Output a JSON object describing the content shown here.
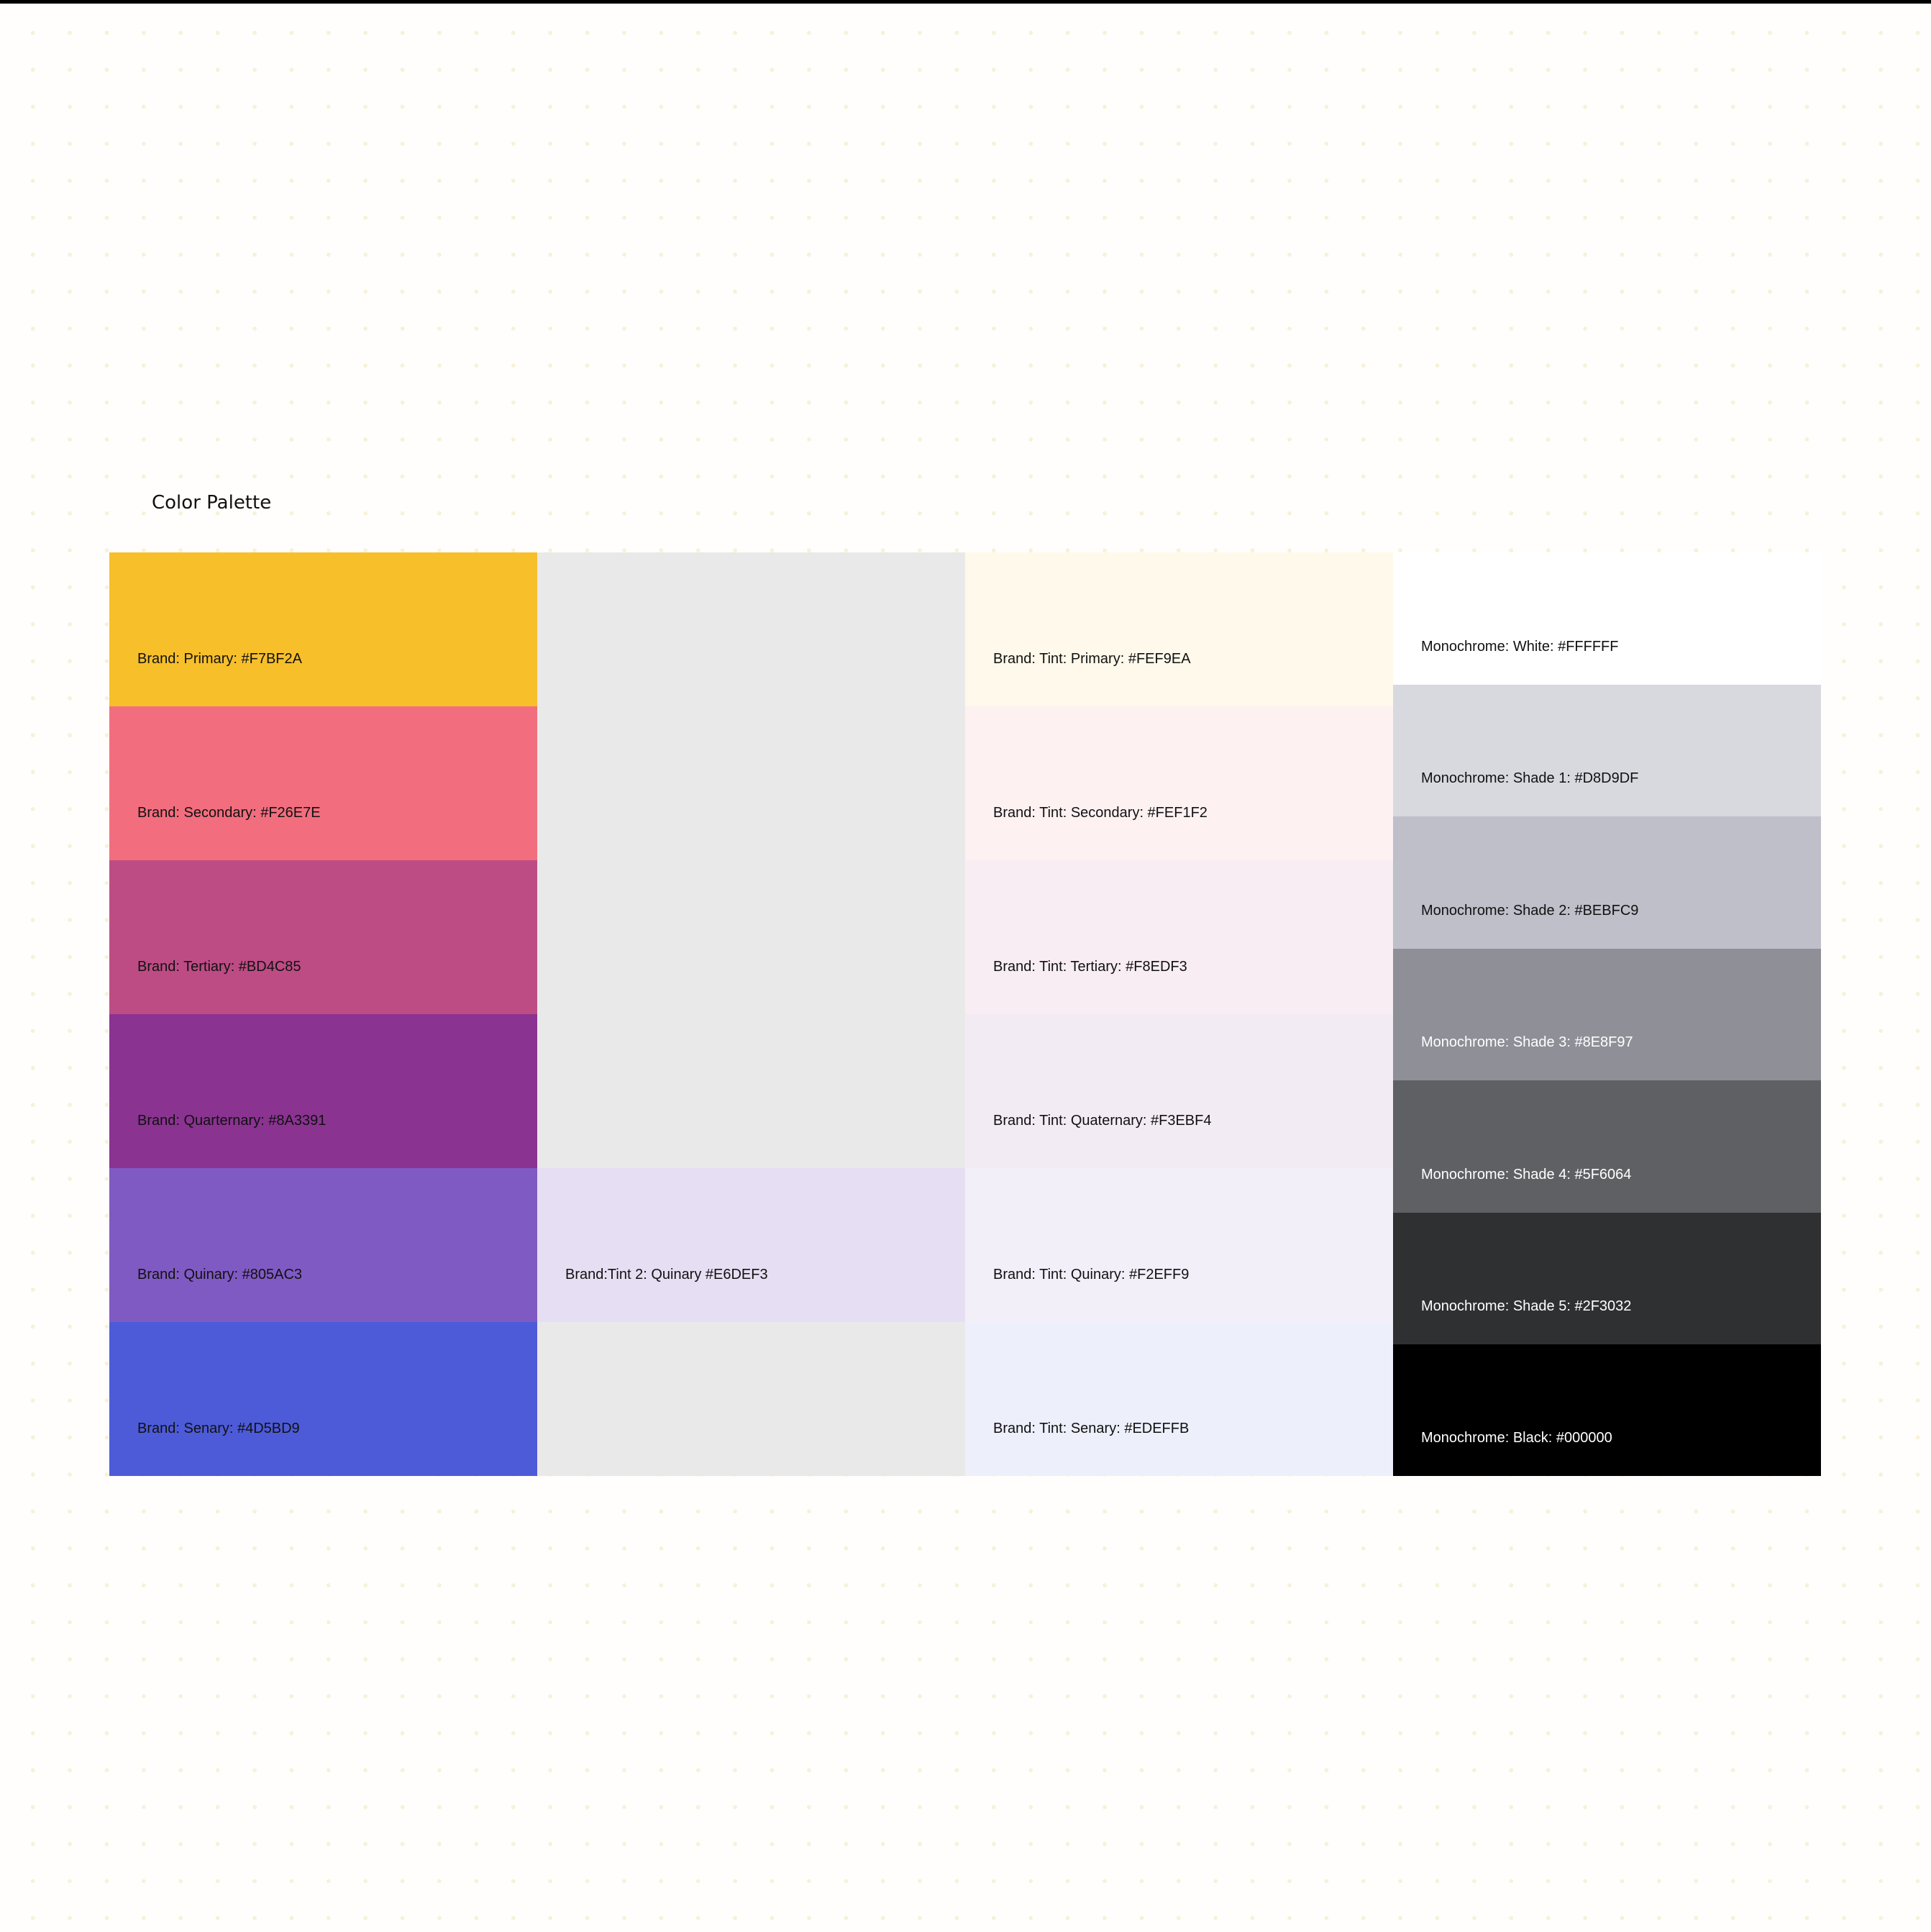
{
  "page": {
    "title": "Color Palette"
  },
  "brand": {
    "primary": {
      "label": "Brand: Primary: #F7BF2A",
      "color": "#F7BF2A"
    },
    "secondary": {
      "label": "Brand: Secondary: #F26E7E",
      "color": "#F26E7E"
    },
    "tertiary": {
      "label": "Brand: Tertiary: #BD4C85",
      "color": "#BD4C85"
    },
    "quaternary": {
      "label": "Brand: Quarternary: #8A3391",
      "color": "#8A3391"
    },
    "quinary": {
      "label": "Brand: Quinary: #805AC3",
      "color": "#805AC3"
    },
    "senary": {
      "label": "Brand: Senary: #4D5BD9",
      "color": "#4D5BD9"
    }
  },
  "tint2": {
    "quinary": {
      "label": "Brand:Tint 2: Quinary #E6DEF3",
      "color": "#E6DEF3"
    }
  },
  "tint": {
    "primary": {
      "label": "Brand: Tint: Primary: #FEF9EA",
      "color": "#FEF9EA"
    },
    "secondary": {
      "label": "Brand: Tint: Secondary: #FEF1F2",
      "color": "#FEF1F2"
    },
    "tertiary": {
      "label": "Brand: Tint: Tertiary: #F8EDF3",
      "color": "#F8EDF3"
    },
    "quaternary": {
      "label": "Brand: Tint: Quaternary: #F3EBF4",
      "color": "#F3EBF4"
    },
    "quinary": {
      "label": "Brand: Tint: Quinary: #F2EFF9",
      "color": "#F2EFF9"
    },
    "senary": {
      "label": "Brand: Tint: Senary: #EDEFFB",
      "color": "#EDEFFB"
    }
  },
  "mono": {
    "white": {
      "label": "Monochrome: White: #FFFFFF",
      "color": "#FFFFFF"
    },
    "shade1": {
      "label": "Monochrome: Shade 1: #D8D9DF",
      "color": "#D8D9DF"
    },
    "shade2": {
      "label": "Monochrome: Shade 2: #BEBFC9",
      "color": "#BEBFC9"
    },
    "shade3": {
      "label": "Monochrome: Shade 3: #8E8F97",
      "color": "#8E8F97"
    },
    "shade4": {
      "label": "Monochrome: Shade 4: #5F6064",
      "color": "#5F6064"
    },
    "shade5": {
      "label": "Monochrome: Shade 5: #2F3032",
      "color": "#2F3032"
    },
    "black": {
      "label": "Monochrome: Black: #000000",
      "color": "#000000"
    }
  }
}
